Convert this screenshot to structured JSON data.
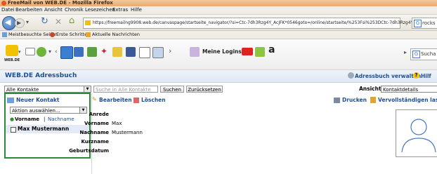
{
  "window": {
    "title": "FreeMail von WEB.DE - Mozilla Firefox"
  },
  "menu": [
    "Datei",
    "Bearbeiten",
    "Ansicht",
    "Chronik",
    "Lesezeichen",
    "Extras",
    "Hilfe"
  ],
  "nav": {
    "url": "https://freemailng9908.web.de/canvaspage/startseite_navigator/?si=Ctc-7dh3Rzg4Y_AcJFK*0546goto=/online/startseite/%253Fsi%253DCtc-7dh3Rzg4Y",
    "search_text": "rocks"
  },
  "bookmarks": [
    "Meistbesuchte Seiten",
    "Erste Schritte",
    "Aktuelle Nachrichten"
  ],
  "toolbar": {
    "logo_text": "WEB.DE",
    "logins_label": "Meine Logins",
    "search_placeholder": "Sucha"
  },
  "app": {
    "title": "WEB.DE Adressbuch",
    "manage_label": "Adressbuch verwalten",
    "help_label": "Hilf"
  },
  "filter": {
    "contacts_select": "Alle Kontakte",
    "search_placeholder": "Suche in Alle Kontakte",
    "search_button": "Suchen",
    "reset_button": "Zurücksetzen",
    "view_label": "Ansicht",
    "view_select": "Kontaktdetails"
  },
  "sidebar": {
    "new_contact": "Neuer Kontakt",
    "action_select": "Aktion auswählen...",
    "sort_first": "Vorname",
    "sort_sep": "|",
    "sort_last": "Nachname",
    "contacts": [
      {
        "name": "Max Mustermann"
      }
    ]
  },
  "details": {
    "edit_label": "Bearbeiten",
    "delete_label": "Löschen",
    "print_label": "Drucken",
    "complete_label": "Vervollständigen lasse",
    "fields": [
      {
        "label": "Anrede",
        "value": ""
      },
      {
        "label": "Vorname",
        "value": "Max"
      },
      {
        "label": "Nachname",
        "value": "Mustermann"
      },
      {
        "label": "Kurzname",
        "value": ""
      },
      {
        "label": "Geburtsdatum",
        "value": ""
      }
    ]
  },
  "colors": {
    "green_highlight": "#2a8a3a",
    "brand_blue": "#1f4f8f",
    "title_bar": "#f3c79a"
  }
}
